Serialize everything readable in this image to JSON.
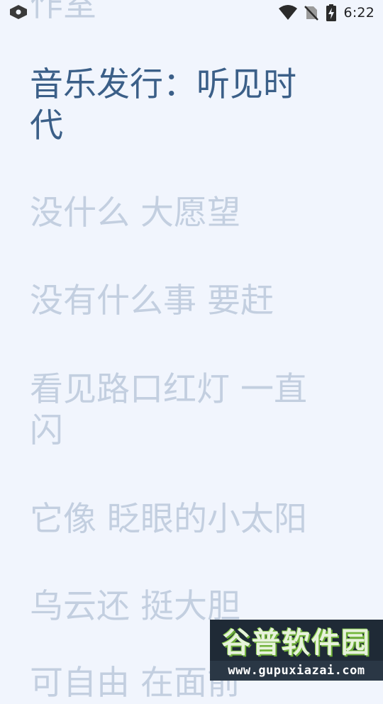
{
  "status_bar": {
    "time": "6:22",
    "icons": [
      "app-notification-icon",
      "wifi-icon",
      "no-sim-icon",
      "battery-charging-icon"
    ]
  },
  "lyrics": {
    "lines": [
      {
        "text": "作室",
        "state": "past"
      },
      {
        "text": "音乐发行：听见时代",
        "state": "current"
      },
      {
        "text": "没什么 大愿望",
        "state": "upcoming"
      },
      {
        "text": "没有什么事 要赶",
        "state": "upcoming"
      },
      {
        "text": "看见路口红灯 一直闪",
        "state": "upcoming"
      },
      {
        "text": "它像 眨眼的小太阳",
        "state": "upcoming"
      },
      {
        "text": "乌云还 挺大胆",
        "state": "upcoming"
      },
      {
        "text": "可自由 在面前",
        "state": "upcoming"
      }
    ],
    "colors": {
      "current": "#3b5f88",
      "inactive": "#c3cfe0",
      "background": "#f1f5fd"
    }
  },
  "watermark": {
    "title": "谷普软件园",
    "url": "www.gupuxiazai.com"
  }
}
